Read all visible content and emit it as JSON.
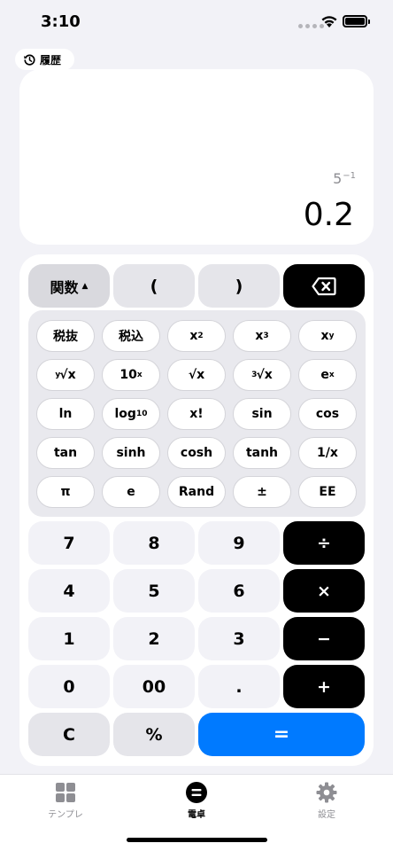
{
  "status": {
    "time": "3:10"
  },
  "history": {
    "label": "履歴",
    "icon": "history-icon"
  },
  "display": {
    "expr_base": "5",
    "expr_exp": "−1",
    "result": "0.2"
  },
  "top_row": {
    "func_label": "関数",
    "func_arrow": "▲",
    "open_paren": "(",
    "close_paren": ")",
    "backspace_icon": "delete-backward-icon"
  },
  "functions": {
    "tax_excl": "税抜",
    "tax_incl": "税込",
    "x2_base": "x",
    "x2_exp": "2",
    "x3_base": "x",
    "x3_exp": "3",
    "xy_base": "x",
    "xy_exp": "y",
    "yroot_pre": "y",
    "yroot_body": "√x",
    "ten_x_base": "10",
    "ten_x_exp": "x",
    "sqrt": "√x",
    "cbrt_pre": "3",
    "cbrt_body": "√x",
    "ex_base": "e",
    "ex_exp": "x",
    "ln": "ln",
    "log_base": "log",
    "log_sub": "10",
    "fact": "x!",
    "sin": "sin",
    "cos": "cos",
    "tan": "tan",
    "sinh": "sinh",
    "cosh": "cosh",
    "tanh": "tanh",
    "recip": "1/x",
    "pi": "π",
    "e": "e",
    "rand": "Rand",
    "plusminus": "±",
    "ee": "EE"
  },
  "keys": {
    "k7": "7",
    "k8": "8",
    "k9": "9",
    "div": "÷",
    "k4": "4",
    "k5": "5",
    "k6": "6",
    "mul": "×",
    "k1": "1",
    "k2": "2",
    "k3": "3",
    "sub": "−",
    "k0": "0",
    "k00": "00",
    "dot": ".",
    "add": "+",
    "clear": "C",
    "percent": "%",
    "equals": "="
  },
  "tabs": [
    {
      "label": "テンプレ",
      "icon": "grid-icon",
      "active": false
    },
    {
      "label": "電卓",
      "icon": "equals-circle-icon",
      "active": true
    },
    {
      "label": "設定",
      "icon": "gear-icon",
      "active": false
    }
  ],
  "colors": {
    "accent": "#007aff",
    "operator": "#000000",
    "background": "#f2f2f7"
  }
}
